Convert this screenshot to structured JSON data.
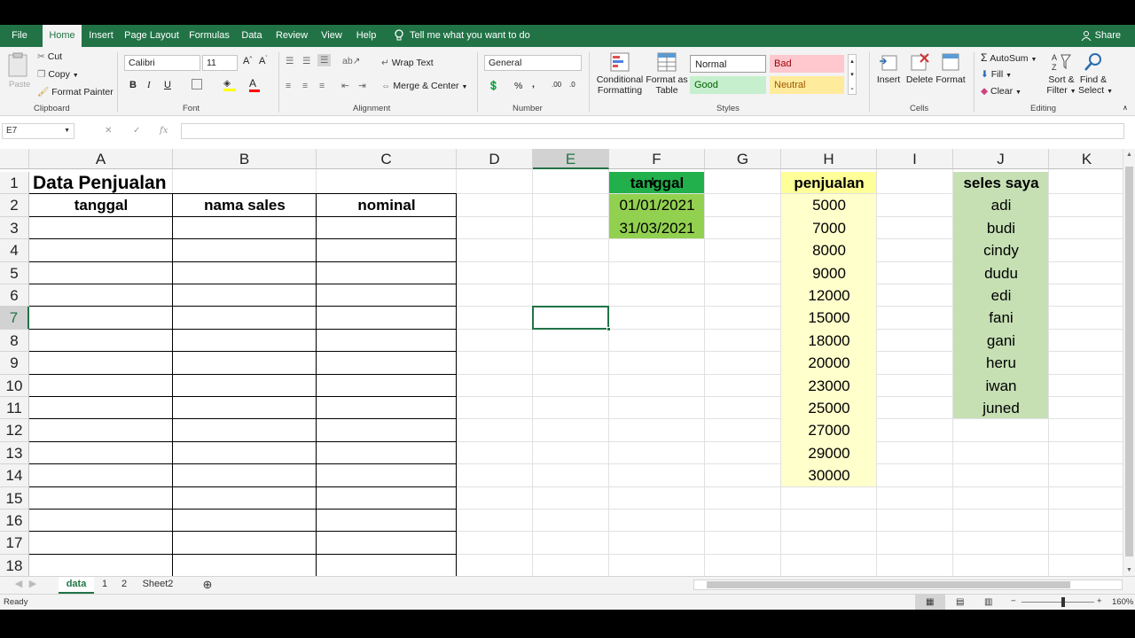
{
  "menu": {
    "tabs": [
      "File",
      "Home",
      "Insert",
      "Page Layout",
      "Formulas",
      "Data",
      "Review",
      "View",
      "Help"
    ],
    "tell_me": "Tell me what you want to do",
    "share": "Share"
  },
  "ribbon": {
    "clipboard": {
      "paste": "Paste",
      "cut": "Cut",
      "copy": "Copy",
      "format_painter": "Format Painter",
      "label": "Clipboard"
    },
    "font": {
      "name": "Calibri",
      "size": "11",
      "bold": "B",
      "italic": "I",
      "underline": "U",
      "label": "Font"
    },
    "alignment": {
      "wrap_text": "Wrap Text",
      "merge_center": "Merge & Center",
      "label": "Alignment"
    },
    "number": {
      "format": "General",
      "percent": "%",
      "comma": ",",
      "label": "Number"
    },
    "styles": {
      "conditional": "Conditional",
      "formatting": "Formatting",
      "format_as": "Format as",
      "table": "Table",
      "normal": "Normal",
      "bad": "Bad",
      "good": "Good",
      "neutral": "Neutral",
      "label": "Styles"
    },
    "cells": {
      "insert": "Insert",
      "delete": "Delete",
      "format": "Format",
      "label": "Cells"
    },
    "editing": {
      "autosum": "AutoSum",
      "fill": "Fill",
      "clear": "Clear",
      "sort": "Sort &",
      "filter": "Filter",
      "find": "Find &",
      "select": "Select",
      "label": "Editing"
    }
  },
  "formula_bar": {
    "name_box": "E7",
    "fx": "fx",
    "value": ""
  },
  "grid": {
    "columns": [
      "A",
      "B",
      "C",
      "D",
      "E",
      "F",
      "G",
      "H",
      "I",
      "J",
      "K"
    ],
    "rows": [
      "1",
      "2",
      "3",
      "4",
      "5",
      "6",
      "7",
      "8",
      "9",
      "10",
      "11",
      "12",
      "13",
      "14",
      "15",
      "16",
      "17",
      "18"
    ],
    "selected_cell": "E7",
    "title": "Data Penjualan",
    "table_headers": [
      "tanggal",
      "nama sales",
      "nominal"
    ],
    "F_header": "tanggal",
    "F_values": [
      "01/01/2021",
      "31/03/2021"
    ],
    "H_header": "penjualan",
    "H_values": [
      "5000",
      "7000",
      "8000",
      "9000",
      "12000",
      "15000",
      "18000",
      "20000",
      "23000",
      "25000",
      "27000",
      "29000",
      "30000"
    ],
    "J_header": "seles saya",
    "J_values": [
      "adi",
      "budi",
      "cindy",
      "dudu",
      "edi",
      "fani",
      "gani",
      "heru",
      "iwan",
      "juned"
    ]
  },
  "sheets": [
    "data",
    "1",
    "2",
    "Sheet2"
  ],
  "active_sheet": "data",
  "status": {
    "ready": "Ready",
    "zoom": "160%"
  },
  "colors": {
    "excel_green": "#217346",
    "header_green": "#21b04b",
    "date_green": "#92d050",
    "light_yellow": "#ffffcc",
    "light_green": "#c6e0b4",
    "bright_yellow": "#ffff99"
  }
}
